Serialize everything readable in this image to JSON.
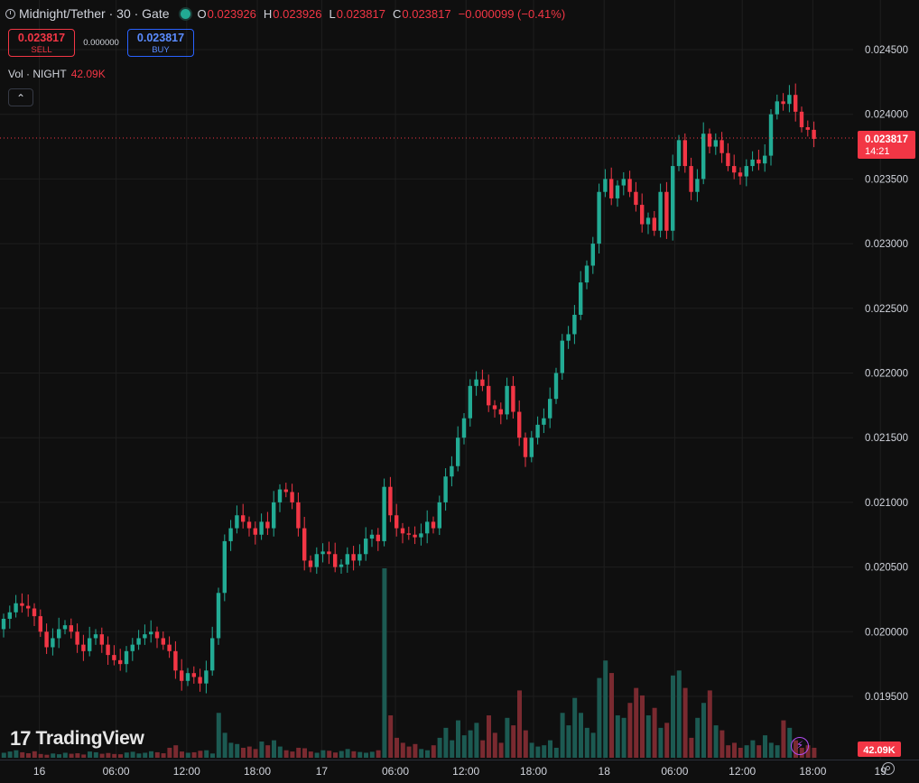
{
  "header": {
    "symbol": "Midnight/Tether · 30 · Gate",
    "o_label": "O",
    "o_value": "0.023926",
    "h_label": "H",
    "h_value": "0.023926",
    "l_label": "L",
    "l_value": "0.023817",
    "c_label": "C",
    "c_value": "0.023817",
    "change": "−0.000099 (−0.41%)"
  },
  "trade": {
    "sell_price": "0.023817",
    "sell_label": "SELL",
    "spread": "0.000000",
    "buy_price": "0.023817",
    "buy_label": "BUY"
  },
  "volume_legend": {
    "label": "Vol · NIGHT",
    "value": "42.09K"
  },
  "collapse_glyph": "⌃",
  "branding": {
    "logo_mark": "17",
    "name": "TradingView"
  },
  "flash_icon": "⚡",
  "colors": {
    "up": "#22ab94",
    "down": "#f23645",
    "background": "#0f0f0f",
    "grid": "#1e1e1e"
  },
  "chart_data": {
    "type": "candlestick",
    "interval": "30",
    "y_ticks": [
      "0.024500",
      "0.024000",
      "0.023500",
      "0.023000",
      "0.022500",
      "0.022000",
      "0.021500",
      "0.021000",
      "0.020500",
      "0.020000",
      "0.019500"
    ],
    "x_ticks": [
      "16",
      "06:00",
      "12:00",
      "18:00",
      "17",
      "06:00",
      "12:00",
      "18:00",
      "18",
      "06:00",
      "12:00",
      "18:00",
      "19"
    ],
    "last_price_label": "0.023817",
    "countdown": "14:21",
    "volume_label": "42.09K",
    "ylim": [
      0.01925,
      0.02475
    ],
    "closes": [
      0.0201,
      0.02015,
      0.02022,
      0.0202,
      0.02018,
      0.02012,
      0.02,
      0.01988,
      0.01995,
      0.02002,
      0.02005,
      0.02,
      0.0199,
      0.01985,
      0.01995,
      0.01998,
      0.0199,
      0.01982,
      0.01978,
      0.01975,
      0.01985,
      0.0199,
      0.01995,
      0.01998,
      0.02,
      0.01995,
      0.0199,
      0.01985,
      0.0197,
      0.01962,
      0.01968,
      0.01965,
      0.0196,
      0.0197,
      0.01995,
      0.0203,
      0.0207,
      0.0208,
      0.0209,
      0.02085,
      0.0208,
      0.02075,
      0.02085,
      0.0208,
      0.021,
      0.0211,
      0.02108,
      0.021,
      0.0208,
      0.02055,
      0.0205,
      0.0206,
      0.02062,
      0.0206,
      0.0205,
      0.02052,
      0.0206,
      0.02055,
      0.0206,
      0.02072,
      0.02075,
      0.0207,
      0.02112,
      0.0209,
      0.0208,
      0.02076,
      0.02075,
      0.02073,
      0.02076,
      0.02085,
      0.0208,
      0.021,
      0.0212,
      0.02128,
      0.0215,
      0.02165,
      0.0219,
      0.02195,
      0.0219,
      0.02175,
      0.02172,
      0.02168,
      0.0219,
      0.0217,
      0.0215,
      0.02135,
      0.0215,
      0.0216,
      0.02165,
      0.0218,
      0.022,
      0.02225,
      0.0223,
      0.02245,
      0.0227,
      0.02283,
      0.023,
      0.0234,
      0.0235,
      0.02335,
      0.02345,
      0.0235,
      0.0234,
      0.0233,
      0.02315,
      0.0232,
      0.0231,
      0.0234,
      0.0231,
      0.0236,
      0.0238,
      0.0236,
      0.0234,
      0.0235,
      0.02385,
      0.02375,
      0.0238,
      0.0237,
      0.0236,
      0.02355,
      0.02352,
      0.0236,
      0.02365,
      0.02362,
      0.02368,
      0.024,
      0.0241,
      0.02408,
      0.02415,
      0.02402,
      0.0239,
      0.02388,
      0.02381
    ],
    "volumes": [
      2000,
      2500,
      3000,
      2200,
      1800,
      2600,
      1500,
      1200,
      1700,
      1400,
      2000,
      1600,
      1800,
      1300,
      2500,
      2200,
      1600,
      1900,
      1500,
      1400,
      2100,
      2400,
      1700,
      2000,
      2600,
      2200,
      1800,
      4000,
      5000,
      2500,
      2000,
      2200,
      2800,
      3000,
      1700,
      18000,
      10000,
      6000,
      5500,
      4000,
      4500,
      3500,
      6500,
      5000,
      7000,
      4500,
      3000,
      2500,
      4000,
      3800,
      2500,
      2000,
      3000,
      2800,
      2100,
      2700,
      3500,
      2600,
      2300,
      2000,
      2400,
      3000,
      76000,
      17000,
      8000,
      6000,
      4500,
      5500,
      3500,
      3000,
      5000,
      8000,
      12000,
      7000,
      15000,
      9000,
      11000,
      14000,
      7000,
      17000,
      10000,
      6000,
      16000,
      13000,
      27000,
      11000,
      6000,
      4500,
      5000,
      7000,
      4000,
      18000,
      13000,
      24000,
      18000,
      12000,
      10000,
      32000,
      39000,
      34000,
      17000,
      16000,
      22000,
      28000,
      25000,
      17000,
      20000,
      12000,
      14000,
      33000,
      35000,
      28000,
      8000,
      16000,
      22000,
      27000,
      13000,
      11000,
      5000,
      6000,
      4000,
      5000,
      7000,
      5000,
      9000,
      6000,
      5000,
      15000,
      12000,
      7000,
      4000,
      5000,
      4000
    ]
  }
}
